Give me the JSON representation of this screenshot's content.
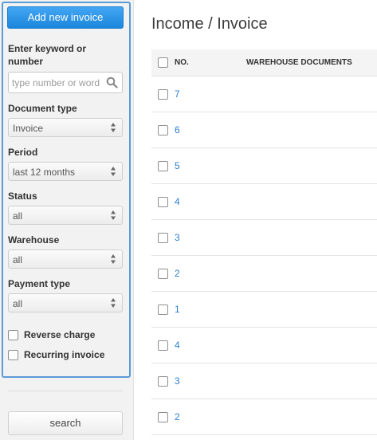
{
  "sidebar": {
    "add_button_label": "Add new invoice",
    "keyword_label": "Enter keyword or number",
    "keyword_placeholder": "type number or word",
    "document_type_label": "Document type",
    "document_type_value": "Invoice",
    "period_label": "Period",
    "period_value": "last 12 months",
    "status_label": "Status",
    "status_value": "all",
    "warehouse_label": "Warehouse",
    "warehouse_value": "all",
    "payment_type_label": "Payment type",
    "payment_type_value": "all",
    "reverse_charge_label": "Reverse charge",
    "recurring_invoice_label": "Recurring invoice",
    "search_button_label": "search"
  },
  "main": {
    "title": "Income / Invoice",
    "columns": [
      "NO.",
      "WAREHOUSE DOCUMENTS"
    ],
    "rows": [
      {
        "no": "7"
      },
      {
        "no": "6"
      },
      {
        "no": "5"
      },
      {
        "no": "4"
      },
      {
        "no": "3"
      },
      {
        "no": "2"
      },
      {
        "no": "1"
      },
      {
        "no": "4"
      },
      {
        "no": "3"
      },
      {
        "no": "2"
      }
    ]
  },
  "colors": {
    "accent": "#1b86db",
    "panel_border": "#5b9bd5",
    "link": "#2e7fd0",
    "sidebar_bg": "#f2f2f2"
  }
}
